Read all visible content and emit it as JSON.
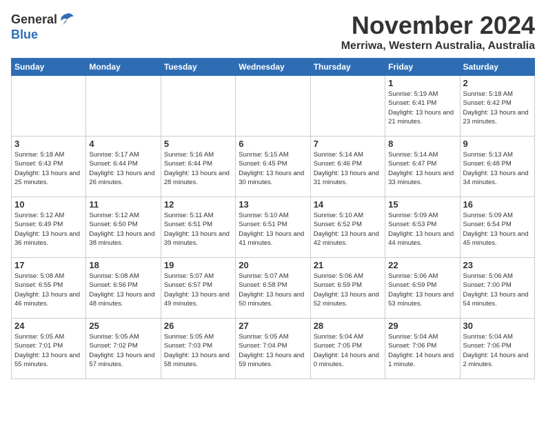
{
  "header": {
    "logo_general": "General",
    "logo_blue": "Blue",
    "month_title": "November 2024",
    "location": "Merriwa, Western Australia, Australia"
  },
  "weekdays": [
    "Sunday",
    "Monday",
    "Tuesday",
    "Wednesday",
    "Thursday",
    "Friday",
    "Saturday"
  ],
  "weeks": [
    [
      {
        "day": "",
        "info": ""
      },
      {
        "day": "",
        "info": ""
      },
      {
        "day": "",
        "info": ""
      },
      {
        "day": "",
        "info": ""
      },
      {
        "day": "",
        "info": ""
      },
      {
        "day": "1",
        "info": "Sunrise: 5:19 AM\nSunset: 6:41 PM\nDaylight: 13 hours\nand 21 minutes."
      },
      {
        "day": "2",
        "info": "Sunrise: 5:18 AM\nSunset: 6:42 PM\nDaylight: 13 hours\nand 23 minutes."
      }
    ],
    [
      {
        "day": "3",
        "info": "Sunrise: 5:18 AM\nSunset: 6:43 PM\nDaylight: 13 hours\nand 25 minutes."
      },
      {
        "day": "4",
        "info": "Sunrise: 5:17 AM\nSunset: 6:44 PM\nDaylight: 13 hours\nand 26 minutes."
      },
      {
        "day": "5",
        "info": "Sunrise: 5:16 AM\nSunset: 6:44 PM\nDaylight: 13 hours\nand 28 minutes."
      },
      {
        "day": "6",
        "info": "Sunrise: 5:15 AM\nSunset: 6:45 PM\nDaylight: 13 hours\nand 30 minutes."
      },
      {
        "day": "7",
        "info": "Sunrise: 5:14 AM\nSunset: 6:46 PM\nDaylight: 13 hours\nand 31 minutes."
      },
      {
        "day": "8",
        "info": "Sunrise: 5:14 AM\nSunset: 6:47 PM\nDaylight: 13 hours\nand 33 minutes."
      },
      {
        "day": "9",
        "info": "Sunrise: 5:13 AM\nSunset: 6:48 PM\nDaylight: 13 hours\nand 34 minutes."
      }
    ],
    [
      {
        "day": "10",
        "info": "Sunrise: 5:12 AM\nSunset: 6:49 PM\nDaylight: 13 hours\nand 36 minutes."
      },
      {
        "day": "11",
        "info": "Sunrise: 5:12 AM\nSunset: 6:50 PM\nDaylight: 13 hours\nand 38 minutes."
      },
      {
        "day": "12",
        "info": "Sunrise: 5:11 AM\nSunset: 6:51 PM\nDaylight: 13 hours\nand 39 minutes."
      },
      {
        "day": "13",
        "info": "Sunrise: 5:10 AM\nSunset: 6:51 PM\nDaylight: 13 hours\nand 41 minutes."
      },
      {
        "day": "14",
        "info": "Sunrise: 5:10 AM\nSunset: 6:52 PM\nDaylight: 13 hours\nand 42 minutes."
      },
      {
        "day": "15",
        "info": "Sunrise: 5:09 AM\nSunset: 6:53 PM\nDaylight: 13 hours\nand 44 minutes."
      },
      {
        "day": "16",
        "info": "Sunrise: 5:09 AM\nSunset: 6:54 PM\nDaylight: 13 hours\nand 45 minutes."
      }
    ],
    [
      {
        "day": "17",
        "info": "Sunrise: 5:08 AM\nSunset: 6:55 PM\nDaylight: 13 hours\nand 46 minutes."
      },
      {
        "day": "18",
        "info": "Sunrise: 5:08 AM\nSunset: 6:56 PM\nDaylight: 13 hours\nand 48 minutes."
      },
      {
        "day": "19",
        "info": "Sunrise: 5:07 AM\nSunset: 6:57 PM\nDaylight: 13 hours\nand 49 minutes."
      },
      {
        "day": "20",
        "info": "Sunrise: 5:07 AM\nSunset: 6:58 PM\nDaylight: 13 hours\nand 50 minutes."
      },
      {
        "day": "21",
        "info": "Sunrise: 5:06 AM\nSunset: 6:59 PM\nDaylight: 13 hours\nand 52 minutes."
      },
      {
        "day": "22",
        "info": "Sunrise: 5:06 AM\nSunset: 6:59 PM\nDaylight: 13 hours\nand 53 minutes."
      },
      {
        "day": "23",
        "info": "Sunrise: 5:06 AM\nSunset: 7:00 PM\nDaylight: 13 hours\nand 54 minutes."
      }
    ],
    [
      {
        "day": "24",
        "info": "Sunrise: 5:05 AM\nSunset: 7:01 PM\nDaylight: 13 hours\nand 55 minutes."
      },
      {
        "day": "25",
        "info": "Sunrise: 5:05 AM\nSunset: 7:02 PM\nDaylight: 13 hours\nand 57 minutes."
      },
      {
        "day": "26",
        "info": "Sunrise: 5:05 AM\nSunset: 7:03 PM\nDaylight: 13 hours\nand 58 minutes."
      },
      {
        "day": "27",
        "info": "Sunrise: 5:05 AM\nSunset: 7:04 PM\nDaylight: 13 hours\nand 59 minutes."
      },
      {
        "day": "28",
        "info": "Sunrise: 5:04 AM\nSunset: 7:05 PM\nDaylight: 14 hours\nand 0 minutes."
      },
      {
        "day": "29",
        "info": "Sunrise: 5:04 AM\nSunset: 7:06 PM\nDaylight: 14 hours\nand 1 minute."
      },
      {
        "day": "30",
        "info": "Sunrise: 5:04 AM\nSunset: 7:06 PM\nDaylight: 14 hours\nand 2 minutes."
      }
    ]
  ]
}
